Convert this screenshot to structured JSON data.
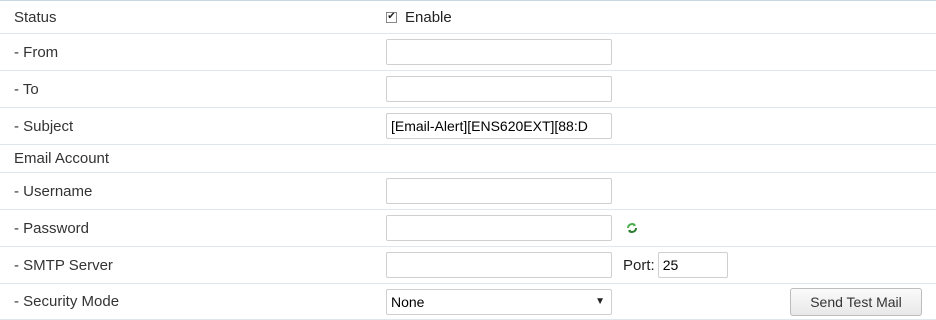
{
  "status": {
    "label": "Status",
    "enable_label": "Enable",
    "enabled": true
  },
  "from": {
    "label": "- From",
    "value": ""
  },
  "to": {
    "label": "- To",
    "value": ""
  },
  "subject": {
    "label": "- Subject",
    "value": "[Email-Alert][ENS620EXT][88:D"
  },
  "email_account": {
    "label": "Email Account"
  },
  "username": {
    "label": "- Username",
    "value": ""
  },
  "password": {
    "label": "- Password",
    "value": "",
    "refresh_icon": "refresh-icon"
  },
  "smtp": {
    "label": "- SMTP Server",
    "value": "",
    "port_label": "Port:",
    "port_value": "25"
  },
  "security_mode": {
    "label": "- Security Mode",
    "selected": "None"
  },
  "send_test_mail": {
    "label": "Send Test Mail"
  },
  "colors": {
    "refresh_icon": "#4caf50",
    "row_border": "#dfe6ee"
  }
}
